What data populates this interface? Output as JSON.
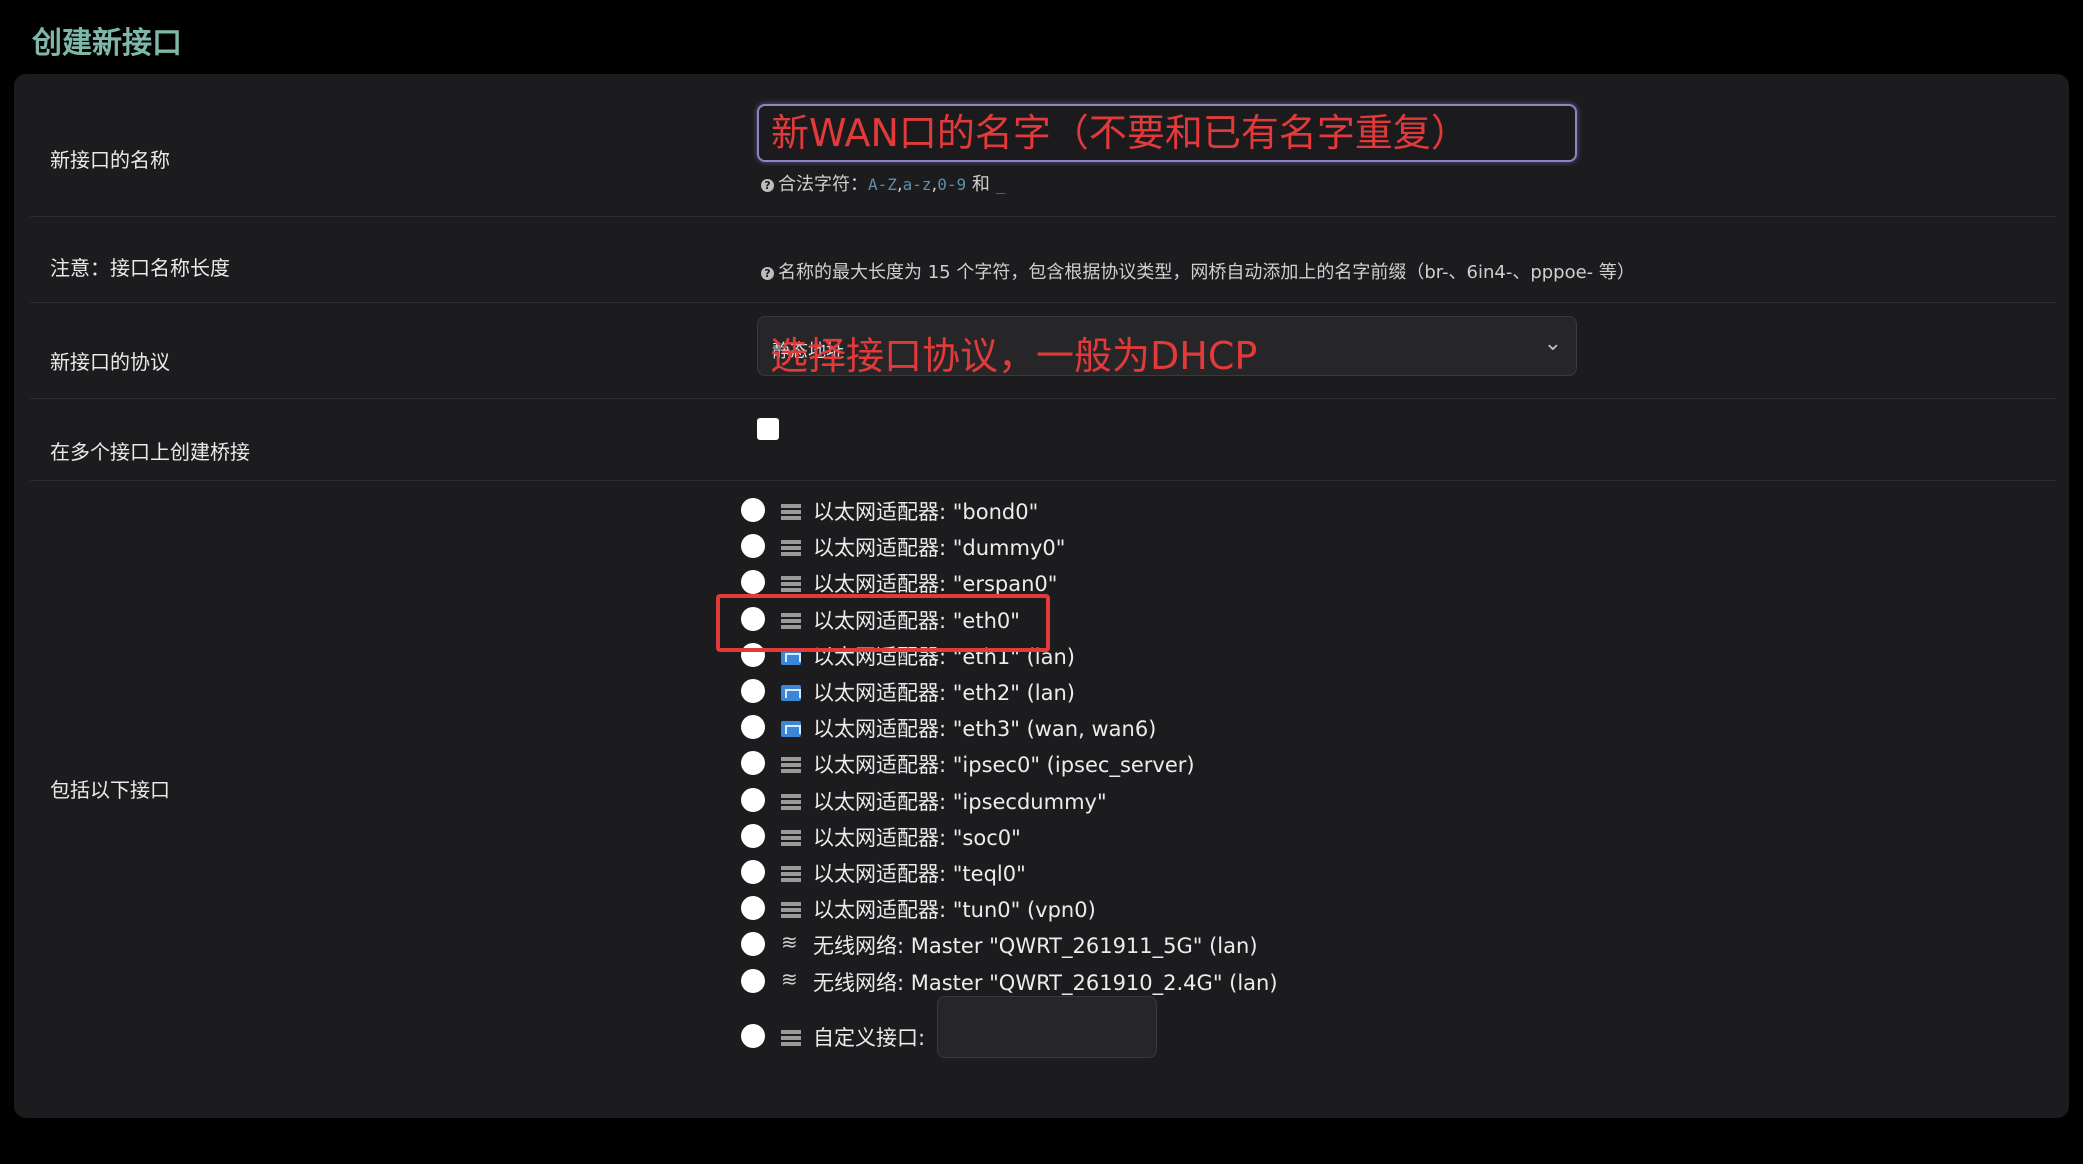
{
  "page": {
    "title": "创建新接口"
  },
  "form": {
    "name_label": "新接口的名称",
    "name_annotation": "新WAN口的名字（不要和已有名字重复）",
    "name_hint": "合法字符：",
    "name_hint_codes": [
      "A-Z",
      "a-z",
      "0-9"
    ],
    "name_hint_and": "和",
    "name_hint_underscore": "_",
    "note_label": "注意：接口名称长度",
    "note_text": "名称的最大长度为 15 个字符，包含根据协议类型，网桥自动添加上的名字前缀（br-、6in4-、pppoe- 等）",
    "protocol_label": "新接口的协议",
    "protocol_value": "静态地址",
    "protocol_annotation": "选择接口协议，一般为DHCP",
    "bridge_label": "在多个接口上创建桥接",
    "include_label": "包括以下接口"
  },
  "interfaces": [
    {
      "label": "以太网适配器: \"bond0\"",
      "icon": "server-icon"
    },
    {
      "label": "以太网适配器: \"dummy0\"",
      "icon": "server-icon"
    },
    {
      "label": "以太网适配器: \"erspan0\"",
      "icon": "server-icon"
    },
    {
      "label": "以太网适配器: \"eth0\"",
      "icon": "server-icon"
    },
    {
      "label": "以太网适配器: \"eth1\" (lan)",
      "icon": "ethernet-port-icon"
    },
    {
      "label": "以太网适配器: \"eth2\" (lan)",
      "icon": "ethernet-port-icon"
    },
    {
      "label": "以太网适配器: \"eth3\" (wan, wan6)",
      "icon": "ethernet-port-icon"
    },
    {
      "label": "以太网适配器: \"ipsec0\" (ipsec_server)",
      "icon": "server-icon"
    },
    {
      "label": "以太网适配器: \"ipsecdummy\"",
      "icon": "server-icon"
    },
    {
      "label": "以太网适配器: \"soc0\"",
      "icon": "server-icon"
    },
    {
      "label": "以太网适配器: \"teql0\"",
      "icon": "server-icon"
    },
    {
      "label": "以太网适配器: \"tun0\" (vpn0)",
      "icon": "server-icon"
    },
    {
      "label": "无线网络: Master \"QWRT_261911_5G\" (lan)",
      "icon": "wifi-icon"
    },
    {
      "label": "无线网络: Master \"QWRT_261910_2.4G\" (lan)",
      "icon": "wifi-icon"
    }
  ],
  "custom_interface": {
    "label": "自定义接口:",
    "icon": "server-icon",
    "value": ""
  },
  "colors": {
    "accent_title": "#7fb7a8",
    "annotation_red": "#e23a3a",
    "input_focus": "#8d83c7"
  }
}
